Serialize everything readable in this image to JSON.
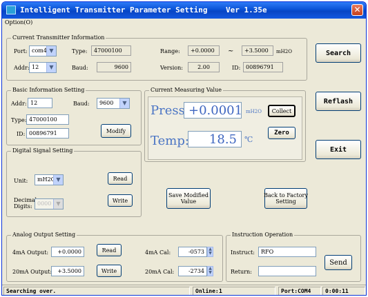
{
  "window": {
    "title": "Intelligent Transmitter Parameter Setting    Ver 1.35e",
    "close": "✕"
  },
  "menu": {
    "option": "Option(O)"
  },
  "current_info": {
    "legend": "Current Transmitter Information",
    "port_label": "Port:",
    "port_value": "com4",
    "type_label": "Type:",
    "type_value": "47000100",
    "range_label": "Range:",
    "range_low": "+0.0000",
    "range_sep": "~",
    "range_high": "+3.5000",
    "range_unit": "mH2O",
    "addr_label": "Addr:",
    "addr_value": "12",
    "baud_label": "Baud:",
    "baud_value": "9600",
    "version_label": "Version:",
    "version_value": "2.00",
    "id_label": "ID:",
    "id_value": "00896791"
  },
  "basic": {
    "legend": "Basic Information Setting",
    "addr_label": "Addr:",
    "addr_value": "12",
    "baud_label": "Baud:",
    "baud_value": "9600",
    "type_label": "Type:",
    "type_value": "47000100",
    "id_label": "ID:",
    "id_value": "00896791",
    "modify": "Modify"
  },
  "digital": {
    "legend": "Digital Signal Setting",
    "unit_label": "Unit:",
    "unit_value": "mH2O",
    "read": "Read",
    "decimal_label": "Decimal\nDigits:",
    "decimal_value": "0000",
    "write": "Write"
  },
  "measuring": {
    "legend": "Current Measuring Value",
    "press_label": "Press:",
    "press_value": "+0.0001",
    "press_unit": "mH2O",
    "collect": "Collect",
    "temp_label": "Temp:",
    "temp_value": "18.5",
    "temp_unit": "℃",
    "zero": "Zero"
  },
  "middle_buttons": {
    "save": "Save Modified\nValue",
    "factory": "Back to Factory\nSetting"
  },
  "side_buttons": {
    "search": "Search",
    "reflash": "Reflash",
    "exit": "Exit"
  },
  "analog": {
    "legend": "Analog Output Setting",
    "out4_label": "4mA Output:",
    "out4_value": "+0.0000",
    "read": "Read",
    "out20_label": "20mA Output:",
    "out20_value": "+3.5000",
    "write": "Write",
    "cal4_label": "4mA Cal:",
    "cal4_value": "-0573",
    "cal20_label": "20mA Cal:",
    "cal20_value": "-2734"
  },
  "instruction": {
    "legend": "Instruction Operation",
    "instruct_label": "Instruct:",
    "instruct_value": "RFO",
    "return_label": "Return:",
    "return_value": "",
    "send": "Send"
  },
  "status": {
    "message": "Searching over.",
    "online_label": "Online:",
    "online_value": "1",
    "port": "Port:COM4",
    "time": "0:00:11"
  }
}
